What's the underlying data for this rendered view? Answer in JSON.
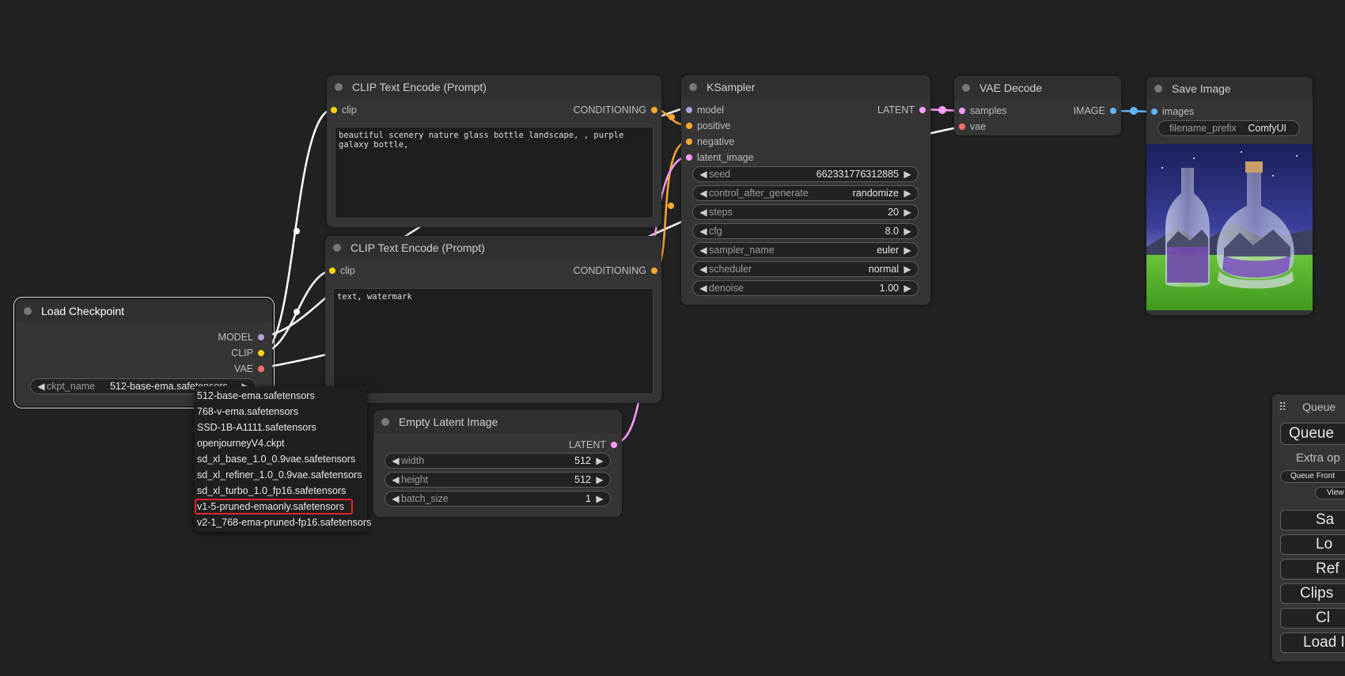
{
  "nodes": {
    "clip_pos": {
      "title": "CLIP Text Encode (Prompt)",
      "input": "clip",
      "output": "CONDITIONING",
      "text": "beautiful scenery nature glass bottle landscape, , purple galaxy bottle,"
    },
    "clip_neg": {
      "title": "CLIP Text Encode (Prompt)",
      "input": "clip",
      "output": "CONDITIONING",
      "text": "text, watermark"
    },
    "ksampler": {
      "title": "KSampler",
      "inputs": [
        "model",
        "positive",
        "negative",
        "latent_image"
      ],
      "output": "LATENT",
      "widgets": [
        {
          "label": "seed",
          "value": "662331776312885"
        },
        {
          "label": "control_after_generate",
          "value": "randomize"
        },
        {
          "label": "steps",
          "value": "20"
        },
        {
          "label": "cfg",
          "value": "8.0"
        },
        {
          "label": "sampler_name",
          "value": "euler"
        },
        {
          "label": "scheduler",
          "value": "normal"
        },
        {
          "label": "denoise",
          "value": "1.00"
        }
      ]
    },
    "vae_decode": {
      "title": "VAE Decode",
      "inputs": [
        "samples",
        "vae"
      ],
      "output": "IMAGE"
    },
    "save_image": {
      "title": "Save Image",
      "input": "images",
      "widget": {
        "label": "filename_prefix",
        "value": "ComfyUI"
      }
    },
    "load_checkpoint": {
      "title": "Load Checkpoint",
      "outputs": [
        "MODEL",
        "CLIP",
        "VAE"
      ],
      "widget": {
        "label": "ckpt_name",
        "value": "512-base-ema.safetensors"
      }
    },
    "empty_latent": {
      "title": "Empty Latent Image",
      "output": "LATENT",
      "widgets": [
        {
          "label": "width",
          "value": "512"
        },
        {
          "label": "height",
          "value": "512"
        },
        {
          "label": "batch_size",
          "value": "1"
        }
      ]
    }
  },
  "dropdown": {
    "options": [
      "512-base-ema.safetensors",
      "768-v-ema.safetensors",
      "SSD-1B-A1111.safetensors",
      "openjourneyV4.ckpt",
      "sd_xl_base_1.0_0.9vae.safetensors",
      "sd_xl_refiner_1.0_0.9vae.safetensors",
      "sd_xl_turbo_1.0_fp16.safetensors",
      "v1-5-pruned-emaonly.safetensors",
      "v2-1_768-ema-pruned-fp16.safetensors"
    ],
    "highlighted": "v1-5-pruned-emaonly.safetensors"
  },
  "queue_panel": {
    "title": "Queue",
    "queue_button": "Queue",
    "extra_options": "Extra op",
    "queue_front": "Queue Front",
    "view": "View",
    "buttons": [
      "Sa",
      "Lo",
      "Ref",
      "Clips",
      "Cl",
      "Load I"
    ]
  },
  "colors": {
    "background": "#222222",
    "node": "#353535",
    "clip": "#ffd500",
    "conditioning": "#ffa931",
    "model": "#b39ddb",
    "latent": "#ff9cf9",
    "vae": "#ff6e6e",
    "image": "#64b5f6",
    "highlight": "#e0262b"
  }
}
